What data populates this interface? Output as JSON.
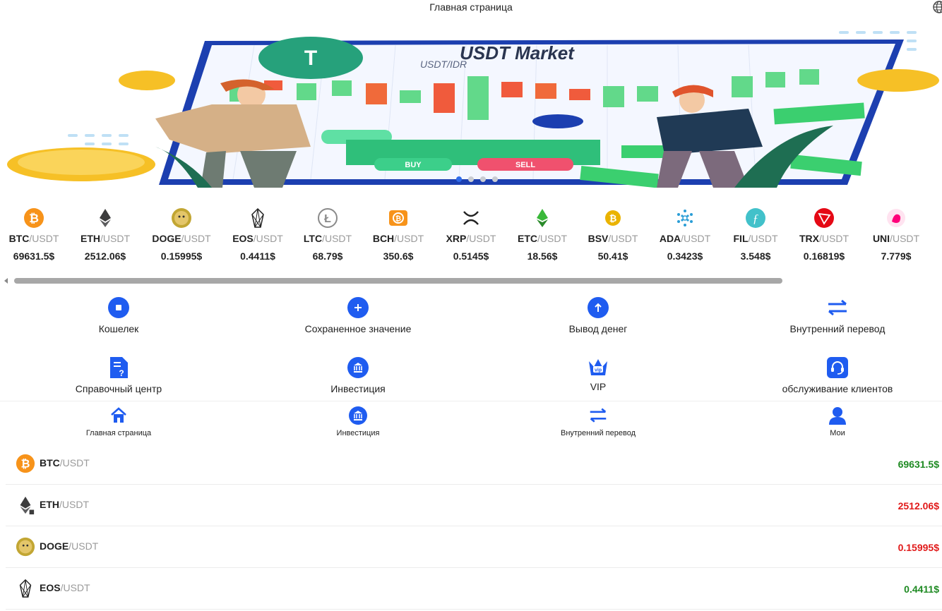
{
  "header": {
    "title": "Главная страница",
    "language_icon": "globe-icon"
  },
  "banner": {
    "headline": "USDT Market",
    "subheadline": "USDT/IDR",
    "buy_label": "BUY",
    "sell_label": "SELL",
    "slides": 4,
    "active_slide": 1
  },
  "ticker": [
    {
      "base": "BTC",
      "quote": "/USDT",
      "price": "69631.5$",
      "icon": "btc-icon",
      "color": "#f7931a"
    },
    {
      "base": "ETH",
      "quote": "/USDT",
      "price": "2512.06$",
      "icon": "eth-icon",
      "color": "#3c3c3d"
    },
    {
      "base": "DOGE",
      "quote": "/USDT",
      "price": "0.15995$",
      "icon": "doge-icon",
      "color": "#c2a633"
    },
    {
      "base": "EOS",
      "quote": "/USDT",
      "price": "0.4411$",
      "icon": "eos-icon",
      "color": "#222222"
    },
    {
      "base": "LTC",
      "quote": "/USDT",
      "price": "68.79$",
      "icon": "ltc-icon",
      "color": "#8a8a8a"
    },
    {
      "base": "BCH",
      "quote": "/USDT",
      "price": "350.6$",
      "icon": "bch-icon",
      "color": "#f7931a"
    },
    {
      "base": "XRP",
      "quote": "/USDT",
      "price": "0.5145$",
      "icon": "xrp-icon",
      "color": "#222222"
    },
    {
      "base": "ETC",
      "quote": "/USDT",
      "price": "18.56$",
      "icon": "etc-icon",
      "color": "#3ab83a"
    },
    {
      "base": "BSV",
      "quote": "/USDT",
      "price": "50.41$",
      "icon": "bsv-icon",
      "color": "#eab300"
    },
    {
      "base": "ADA",
      "quote": "/USDT",
      "price": "0.3423$",
      "icon": "ada-icon",
      "color": "#2a9dd6"
    },
    {
      "base": "FIL",
      "quote": "/USDT",
      "price": "3.548$",
      "icon": "fil-icon",
      "color": "#42c1ca"
    },
    {
      "base": "TRX",
      "quote": "/USDT",
      "price": "0.16819$",
      "icon": "trx-icon",
      "color": "#e50915"
    },
    {
      "base": "UNI",
      "quote": "/USDT",
      "price": "7.779$",
      "icon": "uni-icon",
      "color": "#ff007a"
    }
  ],
  "menu": [
    {
      "label": "Кошелек",
      "icon": "wallet-icon"
    },
    {
      "label": "Сохраненное значение",
      "icon": "deposit-icon"
    },
    {
      "label": "Вывод денег",
      "icon": "withdraw-icon"
    },
    {
      "label": "Внутренний перевод",
      "icon": "transfer-icon"
    },
    {
      "label": "Справочный центр",
      "icon": "help-document-icon"
    },
    {
      "label": "Инвестиция",
      "icon": "bank-icon"
    },
    {
      "label": "VIP",
      "icon": "vip-crown-icon"
    },
    {
      "label": "обслуживание клиентов",
      "icon": "headset-icon"
    }
  ],
  "bottom_nav": [
    {
      "label": "Главная страница",
      "icon": "home-icon"
    },
    {
      "label": "Инвестиция",
      "icon": "bank-icon"
    },
    {
      "label": "Внутренний перевод",
      "icon": "transfer-icon"
    },
    {
      "label": "Мои",
      "icon": "user-icon"
    }
  ],
  "market_list": [
    {
      "base": "BTC",
      "quote": "/USDT",
      "price": "69631.5$",
      "trend": "up",
      "icon": "btc-icon"
    },
    {
      "base": "ETH",
      "quote": "/USDT",
      "price": "2512.06$",
      "trend": "down",
      "icon": "eth-icon"
    },
    {
      "base": "DOGE",
      "quote": "/USDT",
      "price": "0.15995$",
      "trend": "down",
      "icon": "doge-icon"
    },
    {
      "base": "EOS",
      "quote": "/USDT",
      "price": "0.4411$",
      "trend": "up",
      "icon": "eos-icon"
    }
  ],
  "colors": {
    "accent": "#1f5cf0",
    "up": "#1e8a22",
    "down": "#e11a1a"
  }
}
